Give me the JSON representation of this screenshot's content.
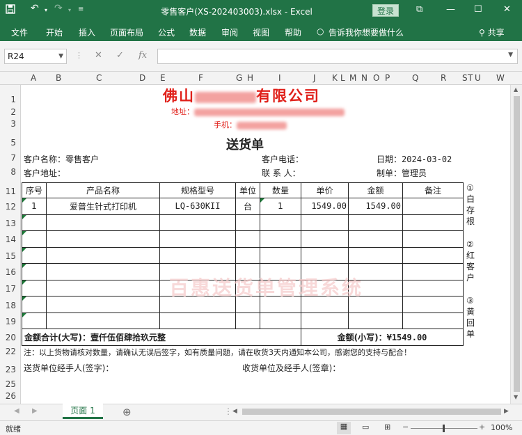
{
  "titlebar": {
    "title": "零售客户(XS-202403003).xlsx  -  Excel",
    "login": "登录",
    "restore_icon": "⧉",
    "minimize_icon": "—",
    "maximize_icon": "☐",
    "close_icon": "✕"
  },
  "ribbon": {
    "tabs": [
      "文件",
      "开始",
      "插入",
      "页面布局",
      "公式",
      "数据",
      "审阅",
      "视图",
      "帮助"
    ],
    "tell_me": "告诉我你想要做什么",
    "share": "共享"
  },
  "formula_bar": {
    "name_box": "R24",
    "fx": "fx",
    "cancel": "✕",
    "enter": "✓",
    "value": ""
  },
  "columns": [
    "A",
    "B",
    "C",
    "D",
    "E",
    "F",
    "G",
    "H",
    "I",
    "J",
    "K",
    "L",
    "M",
    "N",
    "O",
    "P",
    "Q",
    "R",
    "S",
    "T",
    "U",
    "W"
  ],
  "rows": [
    "1",
    "2",
    "3",
    "5",
    "7",
    "8",
    "11",
    "12",
    "13",
    "14",
    "15",
    "16",
    "17",
    "18",
    "19",
    "20",
    "22",
    "23",
    "25",
    "26"
  ],
  "invoice": {
    "company_prefix": "佛山",
    "company_suffix": "有限公司",
    "address_label": "地址：",
    "phone_label": "手机：",
    "heading": "送货单",
    "customer_name_label": "客户名称：",
    "customer_name": "零售客户",
    "customer_phone_label": "客户电话：",
    "date_label": "日期：",
    "date": "2024-03-02",
    "customer_addr_label": "客户地址：",
    "contact_label": "联 系 人：",
    "maker_label": "制单：",
    "maker": "管理员",
    "table_headers": [
      "序号",
      "产品名称",
      "规格型号",
      "单位",
      "数量",
      "单价",
      "金额",
      "备注"
    ],
    "line_items": [
      {
        "no": "1",
        "name": "爱普生针式打印机",
        "model": "LQ-630KII",
        "unit": "台",
        "qty": "1",
        "price": "1549.00",
        "amount": "1549.00",
        "note": ""
      }
    ],
    "total_upper_label": "金额合计(大写)：",
    "total_upper": "壹仟伍佰肆拾玖元整",
    "total_lower_label": "金额(小写)：",
    "total_lower": "¥1549.00",
    "note": "注：以上货物请核对数量，请确认无误后签字，如有质量问题，请在收货3天内通知本公司，感谢您的支持与配合！",
    "sender_sign": "送货单位经手人(签字)：",
    "receiver_sign": "收货单位及经手人(签章)：",
    "watermark": "百惠送货单管理系统",
    "copy_notes": [
      "①白存根",
      "②红客户",
      "③黄回单"
    ]
  },
  "sheet_tabs": {
    "active": "页面 1",
    "add": "⊕"
  },
  "status": {
    "ready": "就绪",
    "zoom": "100%"
  }
}
